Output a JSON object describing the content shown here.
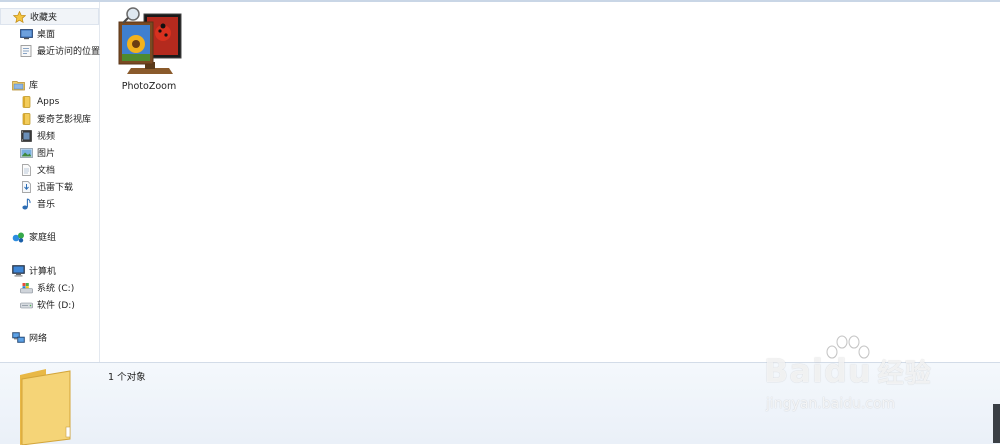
{
  "nav": {
    "favorites": {
      "label": "收藏夹",
      "icon": "star-icon"
    },
    "favorites_items": [
      {
        "label": "桌面",
        "icon": "desktop-icon"
      },
      {
        "label": "最近访问的位置",
        "icon": "recent-places-icon"
      }
    ],
    "library": {
      "label": "库",
      "icon": "library-icon"
    },
    "library_items": [
      {
        "label": "Apps",
        "icon": "folder-icon"
      },
      {
        "label": "爱奇艺影视库",
        "icon": "folder-icon"
      },
      {
        "label": "视频",
        "icon": "video-icon"
      },
      {
        "label": "图片",
        "icon": "picture-icon"
      },
      {
        "label": "文档",
        "icon": "document-icon"
      },
      {
        "label": "迅雷下载",
        "icon": "download-icon"
      },
      {
        "label": "音乐",
        "icon": "music-icon"
      }
    ],
    "homegroup": {
      "label": "家庭组",
      "icon": "homegroup-icon"
    },
    "computer": {
      "label": "计算机",
      "icon": "computer-icon"
    },
    "computer_items": [
      {
        "label": "系统 (C:)",
        "icon": "system-drive-icon"
      },
      {
        "label": "软件 (D:)",
        "icon": "drive-icon"
      }
    ],
    "network": {
      "label": "网络",
      "icon": "network-icon"
    }
  },
  "files": [
    {
      "name": "PhotoZoom",
      "icon": "photozoom-app-icon"
    }
  ],
  "details": {
    "count_text": "1 个对象"
  },
  "watermark": {
    "brand": "Bai",
    "brand2": "du",
    "cn": "经验",
    "url": "jingyan.baidu.com"
  },
  "colors": {
    "nav_selected": "#f1f4f8",
    "details_bg": "#eaf0f8",
    "folder": "#f5d477"
  }
}
